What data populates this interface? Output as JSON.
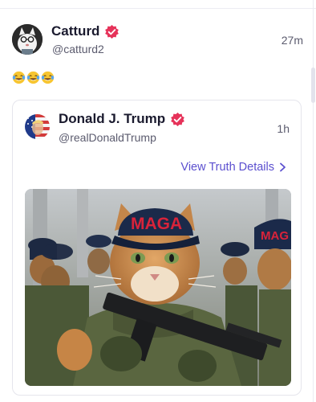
{
  "post": {
    "author_name": "Catturd",
    "author_handle": "@catturd2",
    "time": "27m",
    "text_emoji": [
      "face-with-tears-of-joy",
      "face-with-tears-of-joy",
      "face-with-tears-of-joy"
    ]
  },
  "quote": {
    "author_name": "Donald J. Trump",
    "author_handle": "@realDonaldTrump",
    "time": "1h",
    "view_link": "View Truth Details",
    "image_cap_text": "MAGA",
    "image_cap_text_right": "MAG"
  },
  "colors": {
    "verified_badge": "#e6335a",
    "link": "#5b4fcf",
    "cap": "#1b2a4a",
    "cap_text": "#d9233a"
  }
}
